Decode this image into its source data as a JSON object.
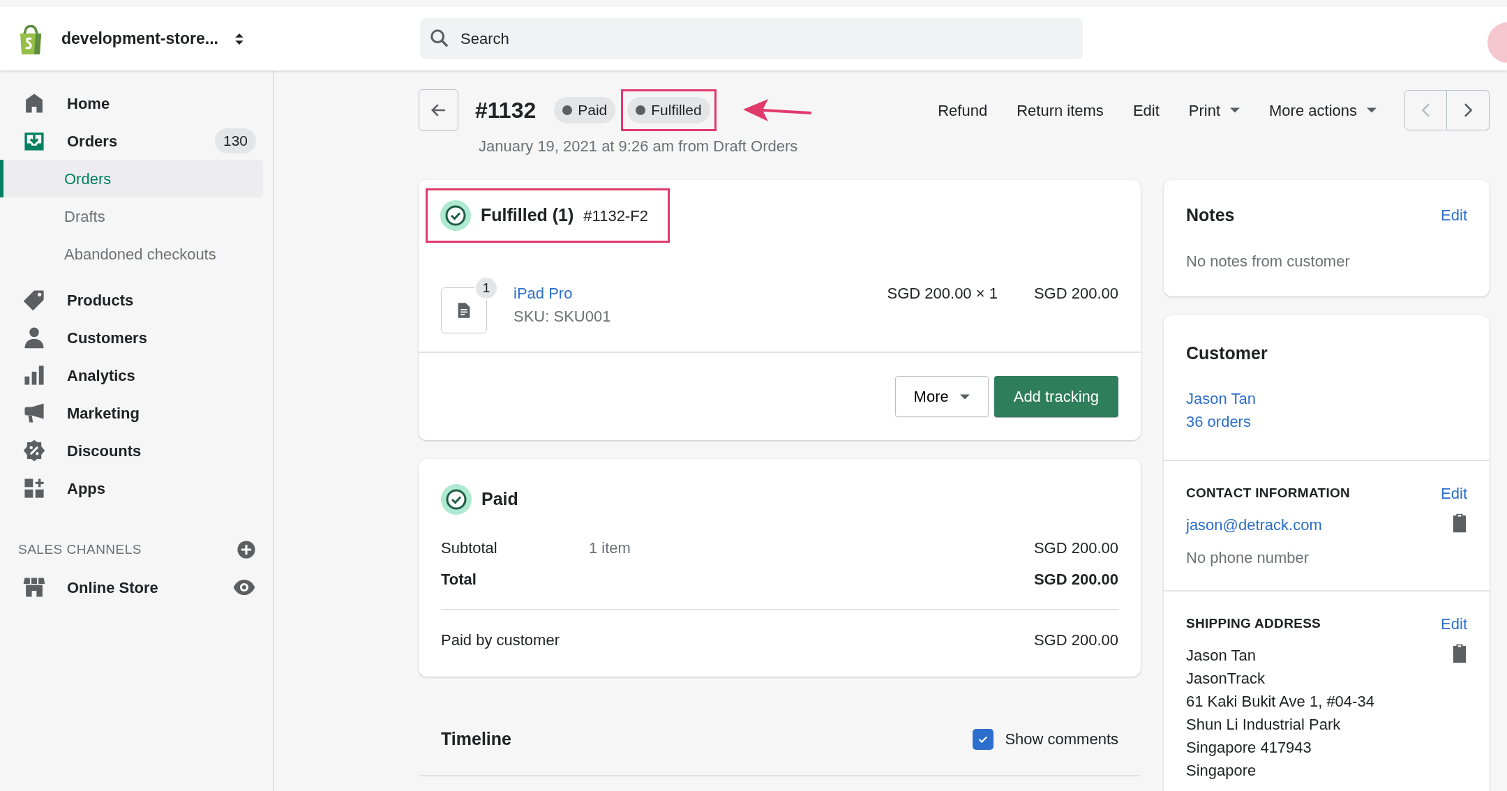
{
  "store": {
    "name": "development-store..."
  },
  "search": {
    "placeholder": "Search"
  },
  "sidebar": {
    "items": [
      {
        "label": "Home",
        "selected": false
      },
      {
        "label": "Orders",
        "selected": true,
        "badge": "130",
        "children": [
          {
            "label": "Orders",
            "selected": true
          },
          {
            "label": "Drafts",
            "selected": false
          },
          {
            "label": "Abandoned checkouts",
            "selected": false
          }
        ]
      },
      {
        "label": "Products",
        "selected": false
      },
      {
        "label": "Customers",
        "selected": false
      },
      {
        "label": "Analytics",
        "selected": false
      },
      {
        "label": "Marketing",
        "selected": false
      },
      {
        "label": "Discounts",
        "selected": false
      },
      {
        "label": "Apps",
        "selected": false
      }
    ],
    "sales_channels": {
      "heading": "SALES CHANNELS",
      "items": [
        {
          "label": "Online Store"
        }
      ]
    }
  },
  "order": {
    "number": "#1132",
    "badges": [
      {
        "label": "Paid",
        "highlighted": false
      },
      {
        "label": "Fulfilled",
        "highlighted": true
      }
    ],
    "subtitle": "January 19, 2021 at 9:26 am from Draft Orders",
    "actions": [
      {
        "label": "Refund",
        "dropdown": false
      },
      {
        "label": "Return items",
        "dropdown": false
      },
      {
        "label": "Edit",
        "dropdown": false
      },
      {
        "label": "Print",
        "dropdown": true
      },
      {
        "label": "More actions",
        "dropdown": true
      }
    ]
  },
  "fulfillment": {
    "title": "Fulfilled (1)",
    "id": "#1132-F2",
    "highlighted": true,
    "line_items": [
      {
        "quantity": "1",
        "name": "iPad Pro",
        "sku": "SKU: SKU001",
        "unit_price": "SGD 200.00 × 1",
        "total": "SGD 200.00"
      }
    ],
    "buttons": [
      {
        "label": "More",
        "kind": "dropdown"
      },
      {
        "label": "Add tracking",
        "kind": "primary"
      }
    ]
  },
  "payment": {
    "title": "Paid",
    "highlighted": false,
    "rows": [
      {
        "label": "Subtotal",
        "detail": "1 item",
        "amount": "SGD 200.00",
        "bold": false,
        "divider_before": false
      },
      {
        "label": "Total",
        "amount": "SGD 200.00",
        "bold": true,
        "divider_before": false
      },
      {
        "label": "Paid by customer",
        "amount": "SGD 200.00",
        "bold": false,
        "divider_before": true
      }
    ]
  },
  "timeline": {
    "title": "Timeline",
    "show_comments": {
      "label": "Show comments",
      "checked": true
    }
  },
  "notes": {
    "title": "Notes",
    "action": "Edit",
    "text": "No notes from customer"
  },
  "customer": {
    "title": "Customer",
    "name": "Jason Tan",
    "orders": "36 orders",
    "sections": [
      {
        "heading": "CONTACT INFORMATION",
        "action": "Edit",
        "copy": true,
        "lines": [
          {
            "text": "jason@detrack.com",
            "kind": "link"
          },
          {
            "text": "No phone number",
            "kind": "muted"
          }
        ]
      },
      {
        "heading": "SHIPPING ADDRESS",
        "action": "Edit",
        "copy": true,
        "lines": [
          {
            "text": "Jason Tan",
            "kind": "plain"
          },
          {
            "text": "JasonTrack",
            "kind": "plain"
          },
          {
            "text": "61 Kaki Bukit Ave 1, #04-34",
            "kind": "plain"
          },
          {
            "text": "Shun Li Industrial Park",
            "kind": "plain"
          },
          {
            "text": "Singapore 417943",
            "kind": "plain"
          },
          {
            "text": "Singapore",
            "kind": "plain"
          }
        ]
      }
    ]
  }
}
